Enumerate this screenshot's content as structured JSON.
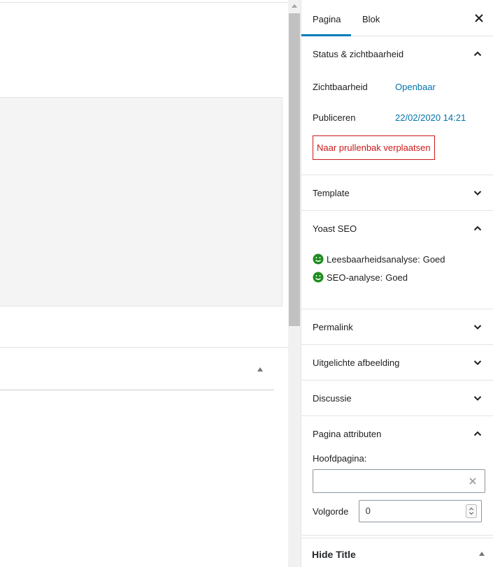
{
  "sidebar": {
    "tabs": [
      {
        "label": "Pagina",
        "active": true
      },
      {
        "label": "Blok",
        "active": false
      }
    ],
    "close_icon": "close-icon",
    "panels": {
      "status": {
        "title": "Status & zichtbaarheid",
        "visibility_label": "Zichtbaarheid",
        "visibility_value": "Openbaar",
        "publish_label": "Publiceren",
        "publish_value": "22/02/2020 14:21",
        "trash_label": "Naar prullenbak verplaatsen"
      },
      "template": {
        "title": "Template"
      },
      "yoast": {
        "title": "Yoast SEO",
        "readability_label": "Leesbaarheidsanalyse:",
        "readability_value": "Goed",
        "seo_label": "SEO-analyse:",
        "seo_value": "Goed"
      },
      "permalink": {
        "title": "Permalink"
      },
      "featured_image": {
        "title": "Uitgelichte afbeelding"
      },
      "discussion": {
        "title": "Discussie"
      },
      "page_attributes": {
        "title": "Pagina attributen",
        "parent_label": "Hoofdpagina:",
        "parent_value": "",
        "order_label": "Volgorde",
        "order_value": "0"
      }
    },
    "hide_title": {
      "label": "Hide Title"
    }
  },
  "colors": {
    "accent": "#007cba",
    "link": "#0073aa",
    "danger": "#cc1818",
    "success": "#1e8c1e"
  }
}
